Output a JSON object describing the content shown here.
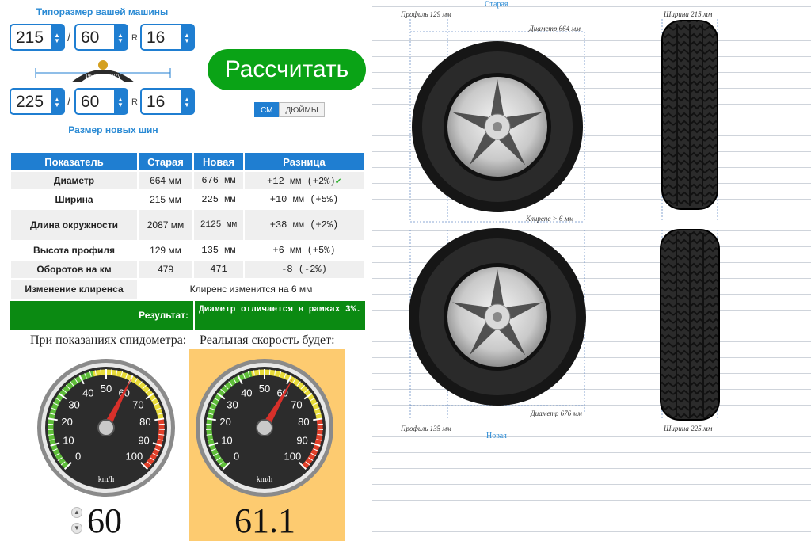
{
  "selector": {
    "current_title": "Типоразмер вашей машины",
    "new_title": "Размер новых шин",
    "current": {
      "width": "215",
      "profile": "60",
      "radius_label": "R",
      "rim": "16"
    },
    "new": {
      "width": "225",
      "profile": "60",
      "radius_label": "R",
      "rim": "16"
    },
    "separator": "/",
    "badge_text": "195 55 R 16 87V"
  },
  "calculate_label": "Рассчитать",
  "units": {
    "cm": "СМ",
    "inch": "ДЮЙМЫ",
    "active": "cm"
  },
  "table": {
    "headers": [
      "Показатель",
      "Старая",
      "Новая",
      "Разница"
    ],
    "rows": [
      {
        "label": "Диаметр",
        "old": "664 мм",
        "new": "676 мм",
        "diff": "+12 мм (+2%)",
        "ok": "✔"
      },
      {
        "label": "Ширина",
        "old": "215 мм",
        "new": "225 мм",
        "diff": "+10 мм (+5%)"
      },
      {
        "label": "Длина окружности",
        "old": "2087 мм",
        "new": "2125 мм",
        "diff": "+38 мм (+2%)"
      },
      {
        "label": "Высота профиля",
        "old": "129 мм",
        "new": "135 мм",
        "diff": "+6 мм (+5%)"
      },
      {
        "label": "Оборотов на км",
        "old": "479",
        "new": "471",
        "diff": "-8 (-2%)"
      }
    ],
    "clearance": {
      "label": "Изменение клиренса",
      "value": "Клиренс изменится на 6 мм"
    },
    "result": {
      "label": "Результат:",
      "value": "Диаметр отличается в рамках 3%."
    }
  },
  "speed": {
    "shown_caption": "При показаниях спидометра:",
    "real_caption": "Реальная скорость будет:",
    "shown_value": "60",
    "real_value": "61.1",
    "unit": "km/h",
    "ticks": [
      "0",
      "10",
      "20",
      "30",
      "40",
      "50",
      "60",
      "70",
      "80",
      "90",
      "100"
    ],
    "max": 100,
    "stepper_up": "▲",
    "stepper_down": "▼"
  },
  "diagram": {
    "old_title": "Старая",
    "new_title": "Новая",
    "old_profile": "Профиль 129 мм",
    "old_diameter": "Диаметр 664 мм",
    "old_width": "Ширина 215 мм",
    "clearance": "Клиренс > 6 мм",
    "new_diameter": "Диаметр 676 мм",
    "new_profile": "Профиль 135 мм",
    "new_width": "Ширина 225 мм"
  },
  "colors": {
    "accent_blue": "#1f7ed1",
    "button_green": "#0aa316",
    "result_green": "#0b8a12",
    "real_speed_bg": "#fdcb70"
  }
}
